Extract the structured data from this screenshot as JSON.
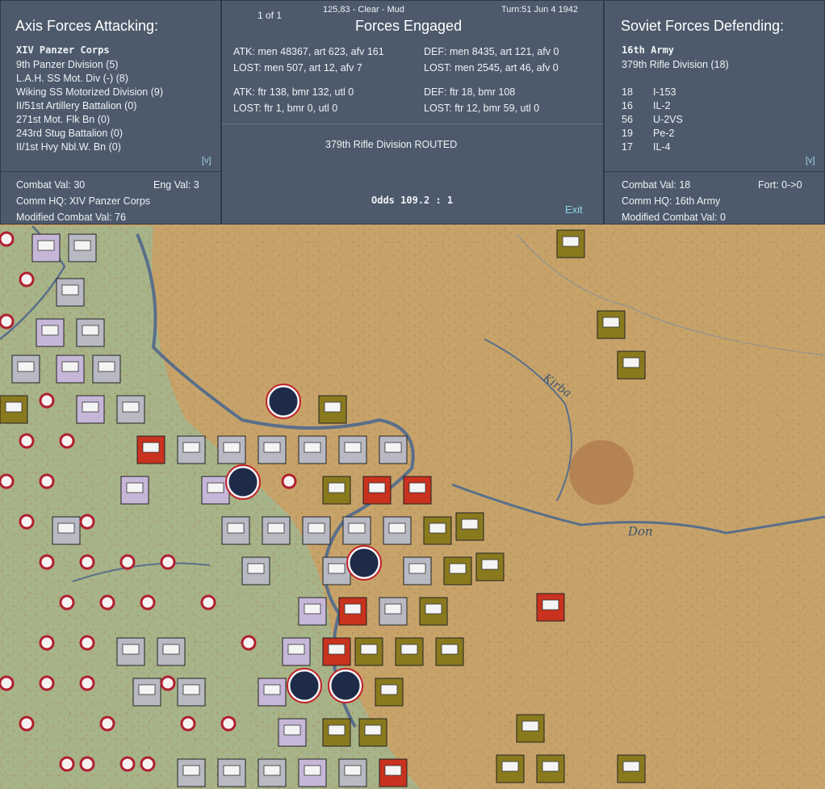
{
  "top_bar": {
    "page": "1 of 1",
    "hex_info": "125,83 - Clear - Mud",
    "turn": "Turn:51  Jun 4 1942"
  },
  "attacker": {
    "title": "Axis Forces Attacking:",
    "hq": "XIV Panzer Corps",
    "units": [
      "9th Panzer Division (5)",
      "L.A.H. SS Mot. Div (-) (8)",
      "Wiking SS Motorized Division (9)",
      "II/51st Artillery Battalion (0)",
      "271st Mot. Flk Bn (0)",
      "243rd Stug Battalion (0)",
      "II/1st Hvy Nbl.W. Bn (0)"
    ],
    "expand": "[v]",
    "combat_val": "Combat Val: 30",
    "eng_val": "Eng Val: 3",
    "comm_hq": "Comm HQ: XIV Panzer Corps",
    "modified": "Modified Combat Val: 76"
  },
  "engaged": {
    "title": "Forces Engaged",
    "atk_ground": "ATK: men 48367, art 623, afv 161",
    "atk_lost": "LOST: men 507, art 12, afv 7",
    "def_ground": "DEF: men 8435, art 121, afv 0",
    "def_lost": "LOST: men 2545, art 46, afv 0",
    "atk_air": "ATK: ftr 138, bmr 132, utl 0",
    "atk_air_lost": "LOST: ftr 1, bmr 0, utl 0",
    "def_air": "DEF: ftr 18, bmr 108",
    "def_air_lost": "LOST: ftr 12, bmr 59, utl 0",
    "result": "379th Rifle Division ROUTED",
    "odds": "Odds 109.2 : 1",
    "exit": "Exit"
  },
  "defender": {
    "title": "Soviet Forces Defending:",
    "hq": "16th Army",
    "unit": "379th Rifle Division (18)",
    "air": [
      {
        "count": "18",
        "type": "I-153"
      },
      {
        "count": "16",
        "type": "IL-2"
      },
      {
        "count": "56",
        "type": "U-2VS"
      },
      {
        "count": "19",
        "type": "Pe-2"
      },
      {
        "count": "17",
        "type": "IL-4"
      }
    ],
    "expand": "[v]",
    "combat_val": "Combat Val: 18",
    "fort": "Fort: 0->0",
    "comm_hq": "Comm HQ: 16th Army",
    "modified": "Modified Combat Val: 0"
  },
  "map": {
    "labels": [
      "Kirba",
      "Don"
    ],
    "colors": {
      "german_armor": "#b8b9c2",
      "german_infantry": "#c6b7d8",
      "soviet": "#8a7a1e",
      "soviet_red": "#c8321e",
      "water": "#5a6f8a"
    }
  }
}
